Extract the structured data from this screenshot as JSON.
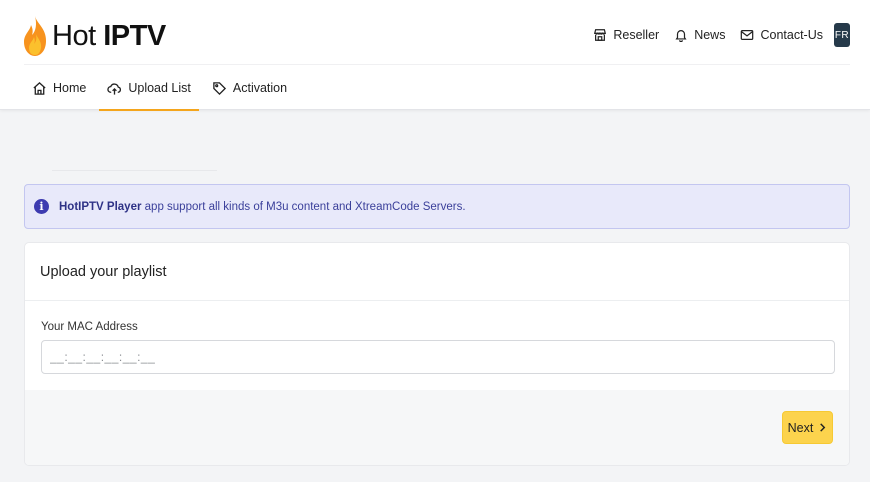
{
  "header": {
    "logo_light": "Hot",
    "logo_bold": "IPTV",
    "links": [
      {
        "label": "Reseller",
        "icon": "store-icon"
      },
      {
        "label": "News",
        "icon": "bell-icon"
      },
      {
        "label": "Contact-Us",
        "icon": "mail-icon"
      }
    ],
    "language": "FR"
  },
  "nav": {
    "items": [
      {
        "label": "Home",
        "icon": "home-icon"
      },
      {
        "label": "Upload List",
        "icon": "cloud-upload-icon",
        "active": true
      },
      {
        "label": "Activation",
        "icon": "tag-icon"
      }
    ]
  },
  "alert": {
    "icon_glyph": "i",
    "strong": "HotIPTV Player",
    "text": " app support all kinds of M3u content and XtreamCode Servers."
  },
  "upload": {
    "title": "Upload your playlist",
    "mac_label": "Your MAC Address",
    "mac_placeholder": "__:__:__:__:__:__",
    "mac_value": "",
    "next_label": "Next"
  },
  "colors": {
    "accent": "#f4a51c",
    "button": "#fcd34d",
    "alert_bg": "#e8e9fa",
    "alert_text": "#3a3f9a",
    "badge": "#263a4a"
  }
}
